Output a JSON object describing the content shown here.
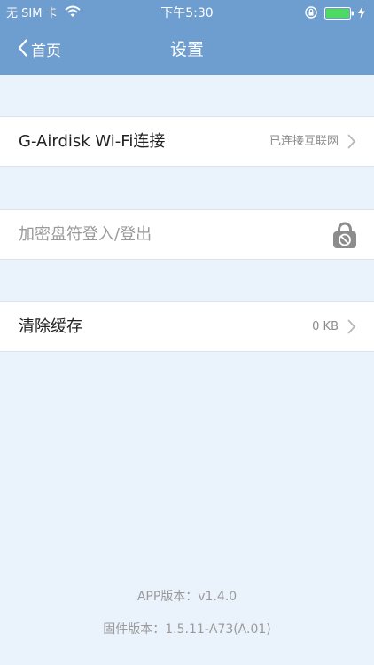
{
  "status_bar": {
    "carrier": "无 SIM 卡",
    "time": "下午5:30",
    "battery_color": "#4cd964"
  },
  "nav": {
    "back_label": "首页",
    "title": "设置"
  },
  "rows": {
    "wifi": {
      "label": "G-Airdisk Wi-Fi连接",
      "value": "已连接互联网"
    },
    "encrypted_drive": {
      "label": "加密盘符登入/登出",
      "icon": "lock-icon"
    },
    "cache": {
      "label": "清除缓存",
      "value": "0 KB"
    }
  },
  "footer": {
    "app_version": "APP版本：v1.4.0",
    "firmware_version": "固件版本：1.5.11-A73(A.01)"
  },
  "colors": {
    "header": "#6e9dd0",
    "background": "#eaf3fc"
  }
}
